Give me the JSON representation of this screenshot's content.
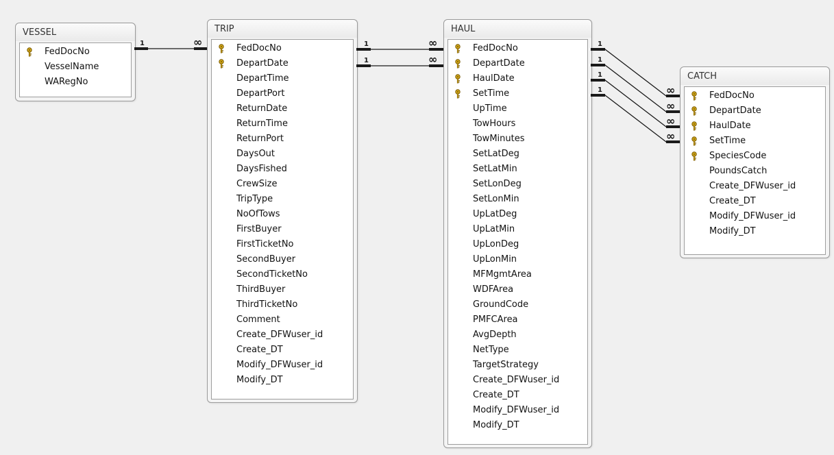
{
  "tables": [
    {
      "id": "vessel",
      "title": "VESSEL",
      "fields": [
        {
          "name": "FedDocNo",
          "key": true
        },
        {
          "name": "VesselName",
          "key": false
        },
        {
          "name": "WARegNo",
          "key": false
        }
      ]
    },
    {
      "id": "trip",
      "title": "TRIP",
      "fields": [
        {
          "name": "FedDocNo",
          "key": true
        },
        {
          "name": "DepartDate",
          "key": true
        },
        {
          "name": "DepartTime",
          "key": false
        },
        {
          "name": "DepartPort",
          "key": false
        },
        {
          "name": "ReturnDate",
          "key": false
        },
        {
          "name": "ReturnTime",
          "key": false
        },
        {
          "name": "ReturnPort",
          "key": false
        },
        {
          "name": "DaysOut",
          "key": false
        },
        {
          "name": "DaysFished",
          "key": false
        },
        {
          "name": "CrewSize",
          "key": false
        },
        {
          "name": "TripType",
          "key": false
        },
        {
          "name": "NoOfTows",
          "key": false
        },
        {
          "name": "FirstBuyer",
          "key": false
        },
        {
          "name": "FirstTicketNo",
          "key": false
        },
        {
          "name": "SecondBuyer",
          "key": false
        },
        {
          "name": "SecondTicketNo",
          "key": false
        },
        {
          "name": "ThirdBuyer",
          "key": false
        },
        {
          "name": "ThirdTicketNo",
          "key": false
        },
        {
          "name": "Comment",
          "key": false
        },
        {
          "name": "Create_DFWuser_id",
          "key": false
        },
        {
          "name": "Create_DT",
          "key": false
        },
        {
          "name": "Modify_DFWuser_id",
          "key": false
        },
        {
          "name": "Modify_DT",
          "key": false
        }
      ]
    },
    {
      "id": "haul",
      "title": "HAUL",
      "fields": [
        {
          "name": "FedDocNo",
          "key": true
        },
        {
          "name": "DepartDate",
          "key": true
        },
        {
          "name": "HaulDate",
          "key": true
        },
        {
          "name": "SetTime",
          "key": true
        },
        {
          "name": "UpTime",
          "key": false
        },
        {
          "name": "TowHours",
          "key": false
        },
        {
          "name": "TowMinutes",
          "key": false
        },
        {
          "name": "SetLatDeg",
          "key": false
        },
        {
          "name": "SetLatMin",
          "key": false
        },
        {
          "name": "SetLonDeg",
          "key": false
        },
        {
          "name": "SetLonMin",
          "key": false
        },
        {
          "name": "UpLatDeg",
          "key": false
        },
        {
          "name": "UpLatMin",
          "key": false
        },
        {
          "name": "UpLonDeg",
          "key": false
        },
        {
          "name": "UpLonMin",
          "key": false
        },
        {
          "name": "MFMgmtArea",
          "key": false
        },
        {
          "name": "WDFArea",
          "key": false
        },
        {
          "name": "GroundCode",
          "key": false
        },
        {
          "name": "PMFCArea",
          "key": false
        },
        {
          "name": "AvgDepth",
          "key": false
        },
        {
          "name": "NetType",
          "key": false
        },
        {
          "name": "TargetStrategy",
          "key": false
        },
        {
          "name": "Create_DFWuser_id",
          "key": false
        },
        {
          "name": "Create_DT",
          "key": false
        },
        {
          "name": "Modify_DFWuser_id",
          "key": false
        },
        {
          "name": "Modify_DT",
          "key": false
        }
      ]
    },
    {
      "id": "catch",
      "title": "CATCH",
      "fields": [
        {
          "name": "FedDocNo",
          "key": true
        },
        {
          "name": "DepartDate",
          "key": true
        },
        {
          "name": "HaulDate",
          "key": true
        },
        {
          "name": "SetTime",
          "key": true
        },
        {
          "name": "SpeciesCode",
          "key": true
        },
        {
          "name": "PoundsCatch",
          "key": false
        },
        {
          "name": "Create_DFWuser_id",
          "key": false
        },
        {
          "name": "Create_DT",
          "key": false
        },
        {
          "name": "Modify_DFWuser_id",
          "key": false
        },
        {
          "name": "Modify_DT",
          "key": false
        }
      ]
    }
  ],
  "relationships": [
    {
      "from": "vessel",
      "to": "trip",
      "field": "FedDocNo",
      "from_cardinality": "1",
      "to_cardinality": "∞"
    },
    {
      "from": "trip",
      "to": "haul",
      "field": "FedDocNo",
      "from_cardinality": "1",
      "to_cardinality": "∞"
    },
    {
      "from": "trip",
      "to": "haul",
      "field": "DepartDate",
      "from_cardinality": "1",
      "to_cardinality": "∞"
    },
    {
      "from": "haul",
      "to": "catch",
      "field": "FedDocNo",
      "from_cardinality": "1",
      "to_cardinality": "∞"
    },
    {
      "from": "haul",
      "to": "catch",
      "field": "DepartDate",
      "from_cardinality": "1",
      "to_cardinality": "∞"
    },
    {
      "from": "haul",
      "to": "catch",
      "field": "HaulDate",
      "from_cardinality": "1",
      "to_cardinality": "∞"
    },
    {
      "from": "haul",
      "to": "catch",
      "field": "SetTime",
      "from_cardinality": "1",
      "to_cardinality": "∞"
    }
  ],
  "colors": {
    "line": "#1a1a1a",
    "key_gold": "#d2a81c",
    "key_outline": "#7a5a00"
  },
  "icons": {
    "primary_key": "key-icon"
  }
}
